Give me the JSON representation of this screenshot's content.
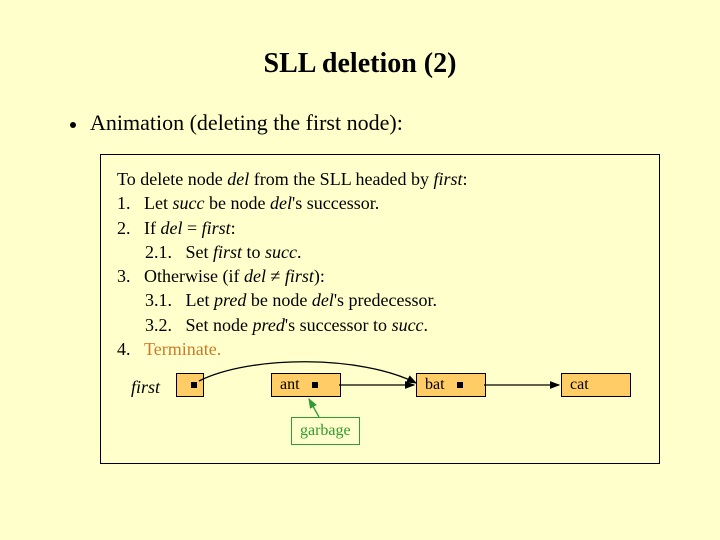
{
  "title": "SLL deletion (2)",
  "bullet": "Animation (deleting the first node):",
  "algo": {
    "intro_pre": "To delete node ",
    "intro_del": "del",
    "intro_mid": " from the SLL headed by ",
    "intro_first": "first",
    "intro_post": ":",
    "s1_num": "1.",
    "s1_a": "Let ",
    "s1_succ": "succ",
    "s1_b": " be node ",
    "s1_del": "del",
    "s1_c": "'s successor.",
    "s2_num": "2.",
    "s2_a": "If ",
    "s2_del": "del",
    "s2_eq": " = ",
    "s2_first": "first",
    "s2_c": ":",
    "s21_num": "2.1.",
    "s21_a": "Set ",
    "s21_first": "first",
    "s21_b": " to ",
    "s21_succ": "succ",
    "s21_c": ".",
    "s3_num": "3.",
    "s3_a": "Otherwise (if ",
    "s3_del": "del",
    "s3_ne": " ≠ ",
    "s3_first": "first",
    "s3_c": "):",
    "s31_num": "3.1.",
    "s31_a": "Let ",
    "s31_pred": "pred",
    "s31_b": " be node ",
    "s31_del": "del",
    "s31_c": "'s predecessor.",
    "s32_num": "3.2.",
    "s32_a": "Set node ",
    "s32_pred": "pred",
    "s32_b": "'s successor to ",
    "s32_succ": "succ",
    "s32_c": ".",
    "s4_num": "4.",
    "s4_txt": "Terminate."
  },
  "diagram": {
    "first_label": "first",
    "node1": "ant",
    "node2": "bat",
    "node3": "cat",
    "garbage": "garbage"
  }
}
